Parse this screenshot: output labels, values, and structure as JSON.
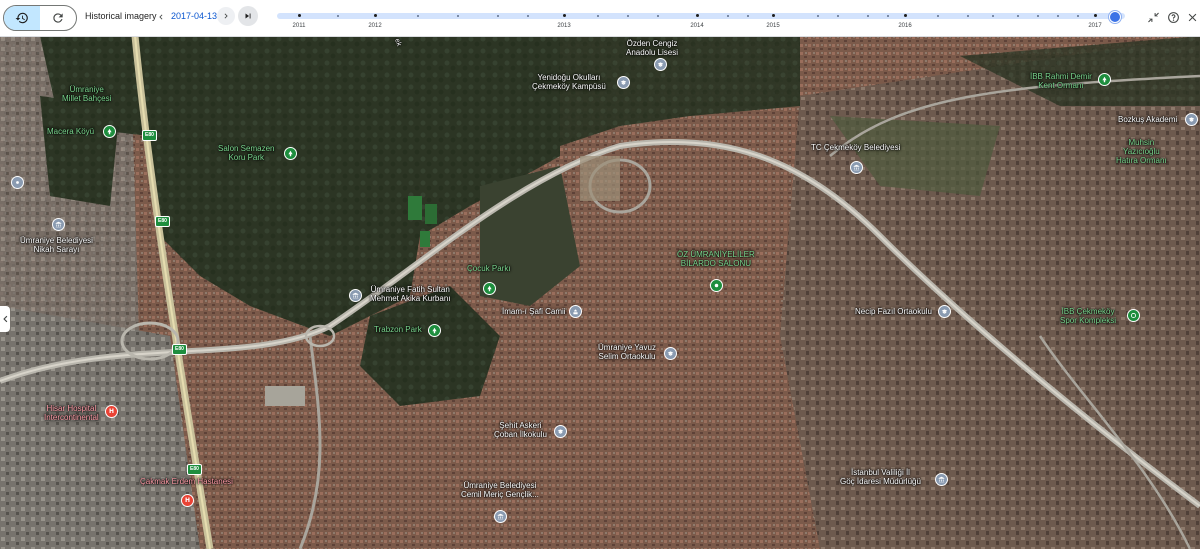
{
  "toolbar": {
    "historical_imagery_label": "Historical imagery",
    "date": "2017-04-13",
    "years": [
      "2011",
      "2012",
      "2013",
      "2014",
      "2015",
      "2016",
      "2017"
    ],
    "selected_year": "2017",
    "accent": "#0b57d0",
    "track_color": "#d3e3fd",
    "icons": [
      "history-icon",
      "refresh-icon",
      "chevron-left-icon",
      "chevron-right-icon",
      "skip-to-end-icon",
      "collapse-icon",
      "help-icon",
      "close-icon"
    ]
  },
  "map": {
    "mode": "satellite",
    "labels": {
      "umraniye_millet_bahcesi": "Ümraniye\nMillet Bahçesi",
      "macera_koyu": "Macera Köyü",
      "salon_semazen": "Salon Semazen\nKoru Park",
      "yenidogu": "Yenidoğu Okulları\nÇekmeköy Kampüsü",
      "ozden_cengiz": "Özden Cengiz\nAnadolu Lisesi",
      "ibb_rahmi_demir": "İBB Rahmi Demir\nKent Ormanı",
      "bozkus_akademi": "Bozkuş Akademi",
      "tc_cekmekoy": "TC Çekmeköy Belediyesi",
      "muhsin_yazicioglu": "Muhsin\nYazıcıoğlu\nHatıra Ormanı",
      "umraniye_belediyesi_nikah": "Ümraniye Belediyesi\nNikah Sarayı",
      "umraniye_fatih_sultan": "Ümraniye Fatih Sultan\nMehmet Akika Kurbanı",
      "cocuk_parki": "Çocuk Parkı",
      "oz_umraniyeliler": "ÖZ ÜMRANİYELİLER\nBİLARDO SALONU",
      "trabzon_park": "Trabzon Park",
      "imam_i_safi": "İmam-ı Şafi Camii",
      "umraniye_yavuz_selim": "Ümraniye Yavuz\nSelim Ortaokulu",
      "necip_fazil": "Necip Fazıl Ortaokulu",
      "ibb_cekmekoy_spor": "İBB Çekmeköy\nSpor Kompleksi",
      "hisar_hospital": "Hisar Hospital\nIntercontinental",
      "sehit_askeri": "Şehit Askeri\nÇoban İlkokulu",
      "cakmak_erdem": "Çakmak Erdem Hastanesi",
      "umraniye_cemil_meric": "Ümraniye Belediyesi\nCemil Meriç Gençlik...",
      "istanbul_valiligi": "İstanbul Valiliği İl\nGöç İdaresi Müdürlüğü",
      "road_e80": "E80",
      "road_partial": "ek"
    },
    "colors": {
      "forest": "#2f3a26",
      "urban": "#7a5a4c",
      "road": "#b9b6ad",
      "label_green": "#7bd88f",
      "label_pink": "#ff9da8",
      "pin_gray": "#8a9bb1",
      "pin_green": "#1e8e3e",
      "pin_red": "#ea4335"
    }
  }
}
